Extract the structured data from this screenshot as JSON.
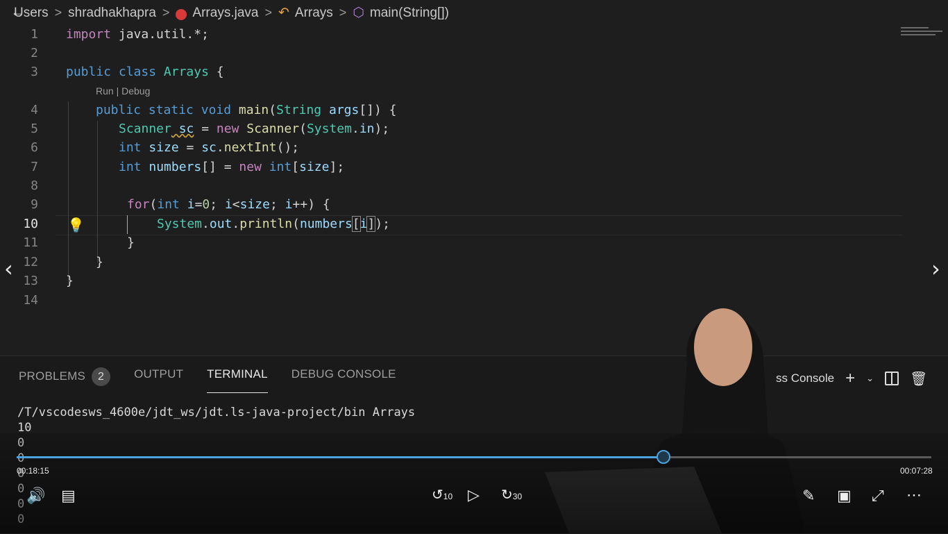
{
  "breadcrumb": {
    "items": [
      "Users",
      "shradhakhapra",
      "Arrays.java",
      "Arrays",
      "main(String[])"
    ]
  },
  "editor": {
    "codelens": "Run | Debug",
    "line_numbers": [
      "1",
      "2",
      "3",
      "4",
      "5",
      "6",
      "7",
      "8",
      "9",
      "10",
      "11",
      "12",
      "13",
      "14"
    ],
    "active_line": "10",
    "code": {
      "l1": [
        "import",
        " java.util.*;"
      ],
      "l3": [
        "public",
        " class",
        " Arrays",
        " {"
      ],
      "l4": [
        "public",
        " static",
        " void",
        " main",
        "(",
        "String",
        " args",
        "[]) {"
      ],
      "l5": [
        "Scanner",
        " sc",
        " = ",
        "new",
        " Scanner",
        "(",
        "System",
        ".",
        "in",
        ");"
      ],
      "l6": [
        "int",
        " size",
        " = ",
        "sc",
        ".",
        "nextInt",
        "();"
      ],
      "l7": [
        "int",
        " numbers",
        "[] = ",
        "new",
        " int",
        "[",
        "size",
        "];"
      ],
      "l9": [
        "for",
        "(",
        "int",
        " i",
        "=",
        "0",
        "; ",
        "i",
        "<",
        "size",
        "; ",
        "i",
        "++) {"
      ],
      "l10": [
        "System",
        ".",
        "out",
        ".",
        "println",
        "(",
        "numbers",
        "[",
        "i",
        "]",
        ");"
      ],
      "l11": "}",
      "l12": "}",
      "l13": "}"
    }
  },
  "panel": {
    "tabs": [
      "PROBLEMS",
      "OUTPUT",
      "TERMINAL",
      "DEBUG CONSOLE"
    ],
    "problems_count": "2",
    "active_tab": "TERMINAL",
    "console_label": "ss Console",
    "terminal_lines": [
      "/T/vscodesws_4600e/jdt_ws/jdt.ls-java-project/bin Arrays",
      "10",
      "0",
      "0",
      "0",
      "0",
      "0",
      "0"
    ]
  },
  "player": {
    "elapsed": "00:18:15",
    "remaining": "00:07:28",
    "progress": 0.706,
    "rewind_label": "10",
    "forward_label": "30",
    "accent": "#4aa3df"
  }
}
